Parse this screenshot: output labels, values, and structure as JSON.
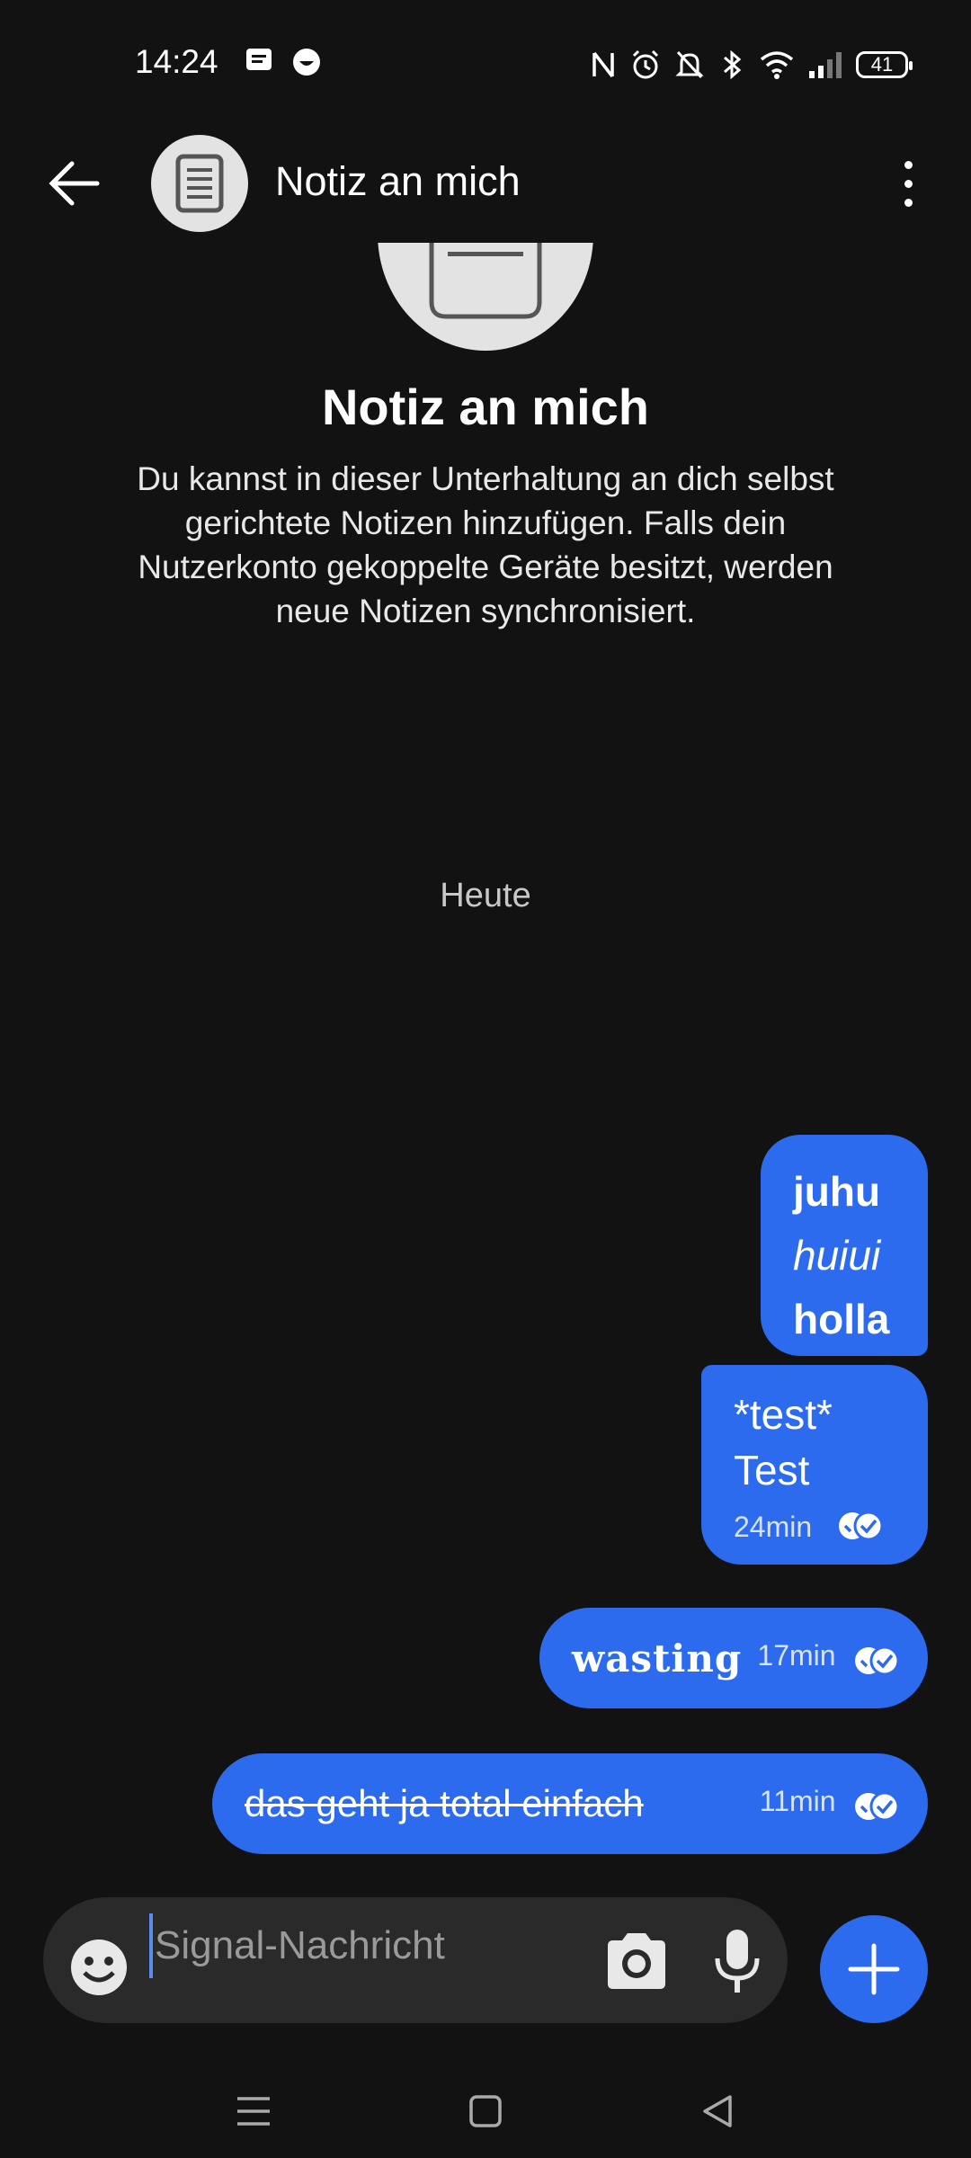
{
  "status_bar": {
    "time": "14:24",
    "battery": "41"
  },
  "toolbar": {
    "title": "Notiz an mich"
  },
  "intro": {
    "title": "Notiz an mich",
    "text": "Du kannst in dieser Unterhaltung an dich selbst gerichtete Notizen hinzufügen. Falls dein Nutzerkonto gekoppelte Geräte besitzt, werden neue Notizen synchronisiert."
  },
  "date_divider": "Heute",
  "messages": [
    {
      "lines": [
        "juhu",
        "huiui",
        "holla"
      ],
      "styles": [
        "bold",
        "italic",
        "bold"
      ]
    },
    {
      "lines": [
        "*test*",
        "Test"
      ],
      "time": "24min"
    },
    {
      "text": "wasting",
      "time": "17min",
      "style": "blackletter"
    },
    {
      "text": "das geht ja total einfach",
      "time": "11min",
      "style": "strikethrough"
    }
  ],
  "composer": {
    "placeholder": "Signal-Nachricht",
    "value": ""
  },
  "colors": {
    "bubble": "#2c6bed",
    "background": "#121212",
    "composer": "#2a2a2a"
  },
  "icons": [
    "back-arrow-icon",
    "note-icon",
    "more-vert-icon",
    "emoji-icon",
    "camera-icon",
    "mic-icon",
    "plus-icon"
  ]
}
